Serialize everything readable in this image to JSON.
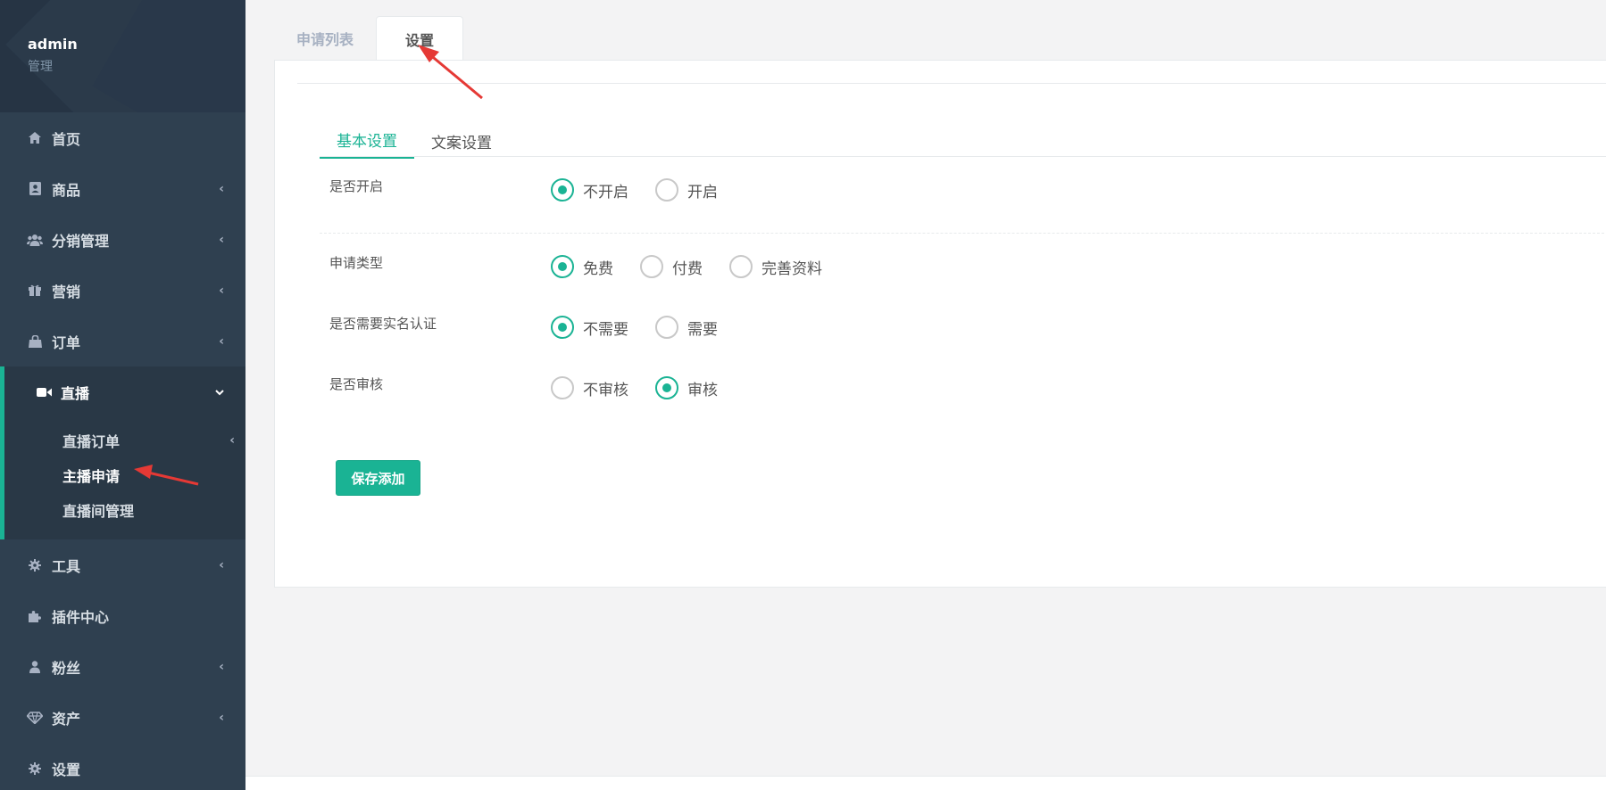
{
  "profile": {
    "name": "admin",
    "role": "管理"
  },
  "sidebar": {
    "items": [
      {
        "label": "首页",
        "icon": "home-icon",
        "has_arrow": false
      },
      {
        "label": "商品",
        "icon": "goods-icon",
        "has_arrow": true
      },
      {
        "label": "分销管理",
        "icon": "users-icon",
        "has_arrow": true
      },
      {
        "label": "营销",
        "icon": "gift-icon",
        "has_arrow": true
      },
      {
        "label": "订单",
        "icon": "bag-icon",
        "has_arrow": true
      },
      {
        "label": "直播",
        "icon": "video-icon",
        "has_arrow": true,
        "open": true
      },
      {
        "label": "工具",
        "icon": "gear-icon",
        "has_arrow": true
      },
      {
        "label": "插件中心",
        "icon": "puzzle-icon",
        "has_arrow": false
      },
      {
        "label": "粉丝",
        "icon": "user-icon",
        "has_arrow": true
      },
      {
        "label": "资产",
        "icon": "diamond-icon",
        "has_arrow": true
      },
      {
        "label": "设置",
        "icon": "gear-icon",
        "has_arrow": false
      }
    ],
    "live_submenu": [
      {
        "label": "直播订单",
        "has_arrow": true
      },
      {
        "label": "主播申请",
        "active": true
      },
      {
        "label": "直播间管理"
      }
    ]
  },
  "tabs": [
    {
      "label": "申请列表",
      "active": false
    },
    {
      "label": "设置",
      "active": true
    }
  ],
  "subtabs": [
    {
      "label": "基本设置",
      "active": true
    },
    {
      "label": "文案设置",
      "active": false
    }
  ],
  "form": {
    "enable": {
      "label": "是否开启",
      "options": [
        "不开启",
        "开启"
      ],
      "selected": "不开启"
    },
    "apply_type": {
      "label": "申请类型",
      "options": [
        "免费",
        "付费",
        "完善资料"
      ],
      "selected": "免费"
    },
    "real_name": {
      "label": "是否需要实名认证",
      "options": [
        "不需要",
        "需要"
      ],
      "selected": "不需要"
    },
    "review": {
      "label": "是否审核",
      "options": [
        "不审核",
        "审核"
      ],
      "selected": "审核"
    }
  },
  "save_label": "保存添加",
  "colors": {
    "accent": "#1ab394",
    "sidebar": "#2f4050",
    "annotation": "#e53935"
  }
}
